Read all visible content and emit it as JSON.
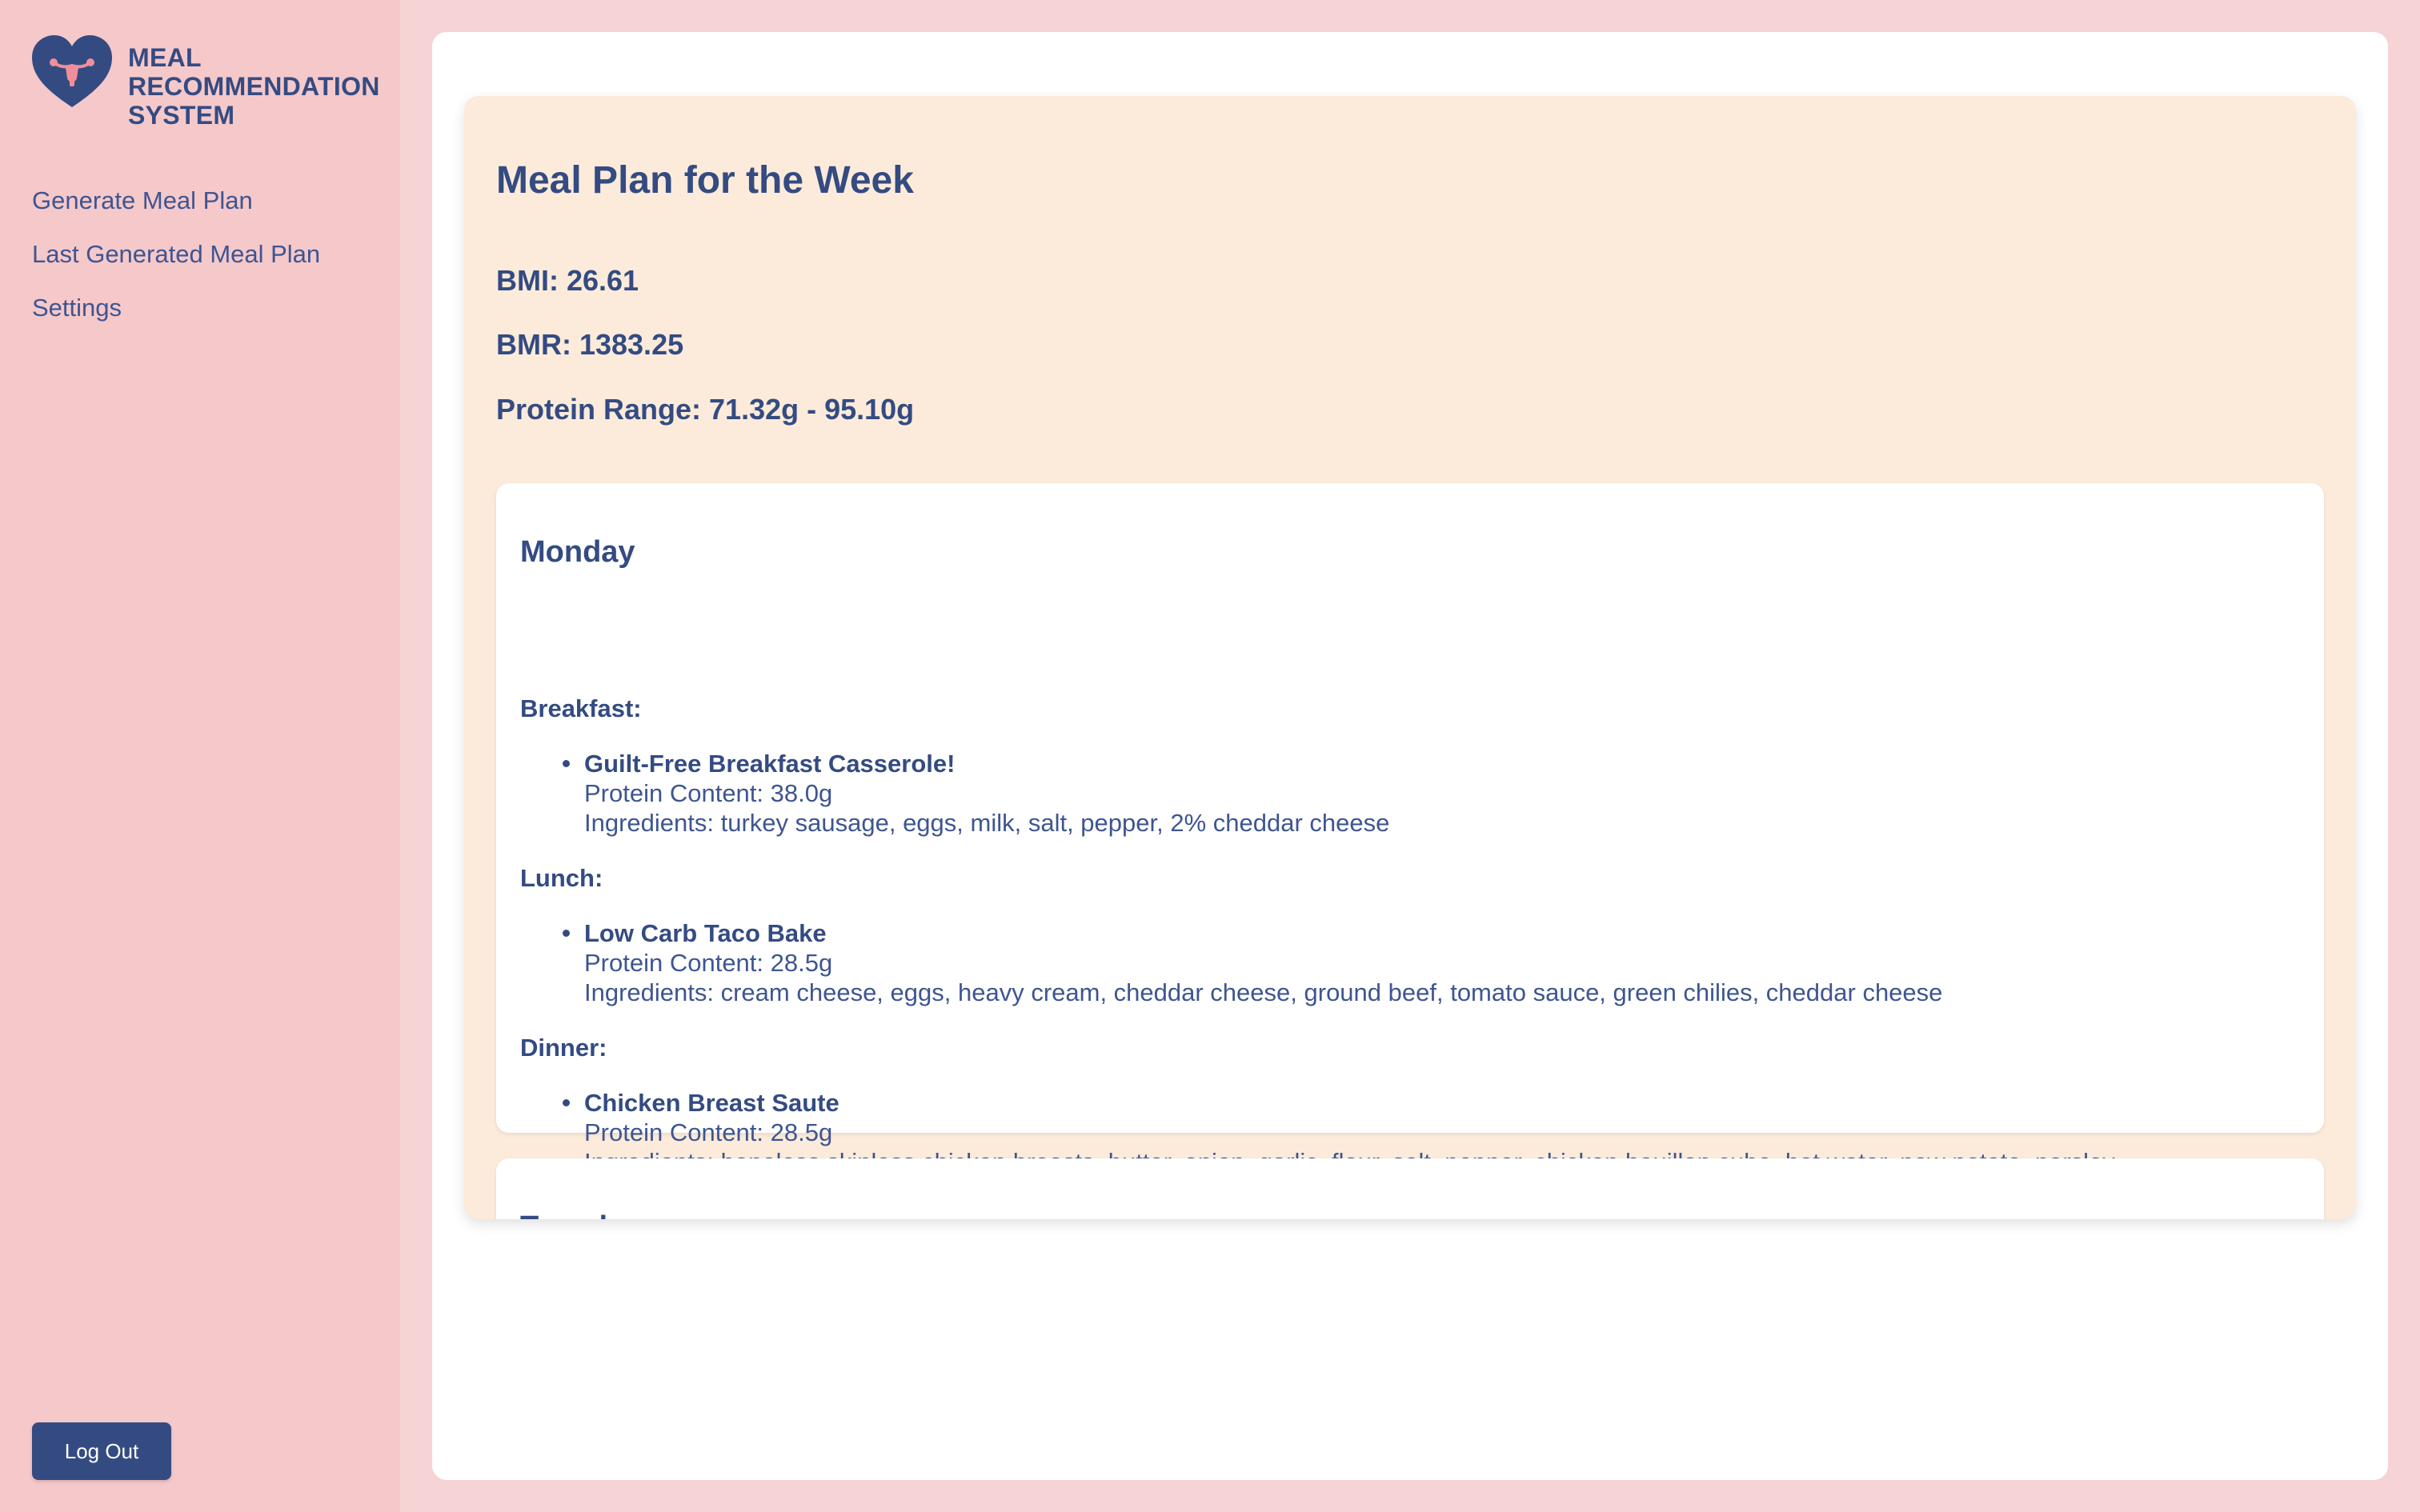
{
  "brand": {
    "title_lines": [
      "MEAL",
      "RECOMMENDATION",
      "SYSTEM"
    ],
    "logo_icon": "heart-uterus-icon",
    "logo_color": "#344b82",
    "logo_accent": "#f08f99"
  },
  "sidebar": {
    "items": [
      {
        "label": "Generate Meal Plan"
      },
      {
        "label": "Last Generated Meal Plan"
      },
      {
        "label": "Settings"
      }
    ],
    "logout_label": "Log Out"
  },
  "plan": {
    "title": "Meal Plan for the Week",
    "bmi": "BMI: 26.61",
    "bmr": "BMR: 1383.25",
    "protein_range": "Protein Range: 71.32g - 95.10g",
    "days": [
      {
        "name": "Monday",
        "meals": [
          {
            "label": "Breakfast:",
            "name": "Guilt-Free Breakfast Casserole!",
            "protein": "Protein Content: 38.0g",
            "ingredients": "Ingredients: turkey sausage, eggs, milk, salt, pepper, 2% cheddar cheese"
          },
          {
            "label": "Lunch:",
            "name": "Low Carb Taco Bake",
            "protein": "Protein Content: 28.5g",
            "ingredients": "Ingredients: cream cheese, eggs, heavy cream, cheddar cheese, ground beef, tomato sauce, green chilies, cheddar cheese"
          },
          {
            "label": "Dinner:",
            "name": "Chicken Breast Saute",
            "protein": "Protein Content: 28.5g",
            "ingredients": "Ingredients: boneless skinless chicken breasts, butter, onion, garlic, flour, salt, pepper, chicken bouillon cube, hot water, new potato, parsley"
          }
        ]
      },
      {
        "name": "Tuesday"
      }
    ]
  },
  "colors": {
    "sidebar_bg": "#f5c8ca",
    "page_bg": "#f6d3d4",
    "plan_bg": "#fcebda",
    "primary": "#344b82"
  }
}
